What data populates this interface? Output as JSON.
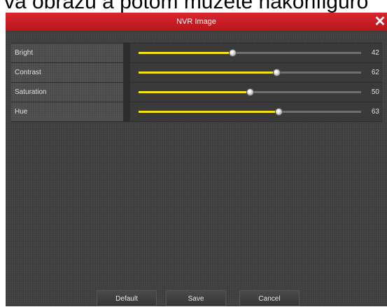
{
  "caption": "va obrazu a potom můžete nakonfiguro",
  "window": {
    "title": "NVR Image",
    "close_symbol": "✕"
  },
  "settings": [
    {
      "label": "Bright",
      "value": 42
    },
    {
      "label": "Contrast",
      "value": 62
    },
    {
      "label": "Saturation",
      "value": 50
    },
    {
      "label": "Hue",
      "value": 63
    }
  ],
  "slider_range": [
    0,
    100
  ],
  "footer": {
    "default_label": "Default",
    "save_label": "Save",
    "cancel_label": "Cancel"
  },
  "colors": {
    "title_bar": "#d22128",
    "slider_fill": "#f4e11a",
    "slider_track": "#6e6e6e",
    "panel": "#3d3d3d"
  },
  "icons": {
    "close": "close-icon",
    "slider_thumb": "slider-thumb-icon"
  }
}
